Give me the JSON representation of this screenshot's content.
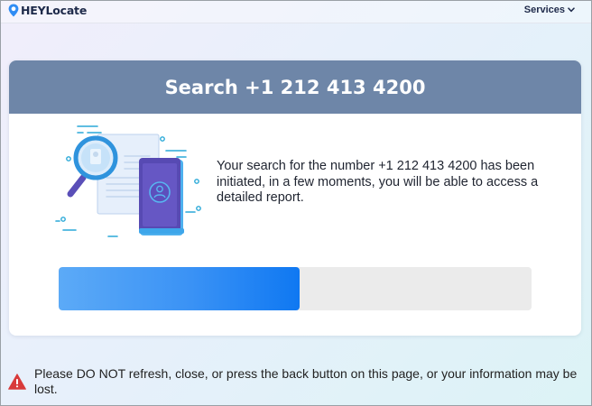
{
  "navbar": {
    "logo_text": "HEYLocate",
    "services_label": "Services"
  },
  "card": {
    "title": "Search +1 212 413 4200",
    "message": "Your search for the number +1 212 413 4200 has been initiated, in a few moments, you will be able to access a detailed report.",
    "progress_fraction": 0.51
  },
  "warning": {
    "text": "Please DO NOT refresh, close, or press the back button on this page, or your information may be lost."
  },
  "colors": {
    "header_bg": "#6e86a8",
    "progress_fill": "#2f8cf4",
    "progress_track": "#ebebeb",
    "warning_red": "#d83a3a",
    "logo_blue": "#2f8cf4"
  },
  "icons": [
    "location-pin-icon",
    "chevron-down-icon",
    "magnifier-icon",
    "phone-user-icon",
    "warning-icon"
  ]
}
